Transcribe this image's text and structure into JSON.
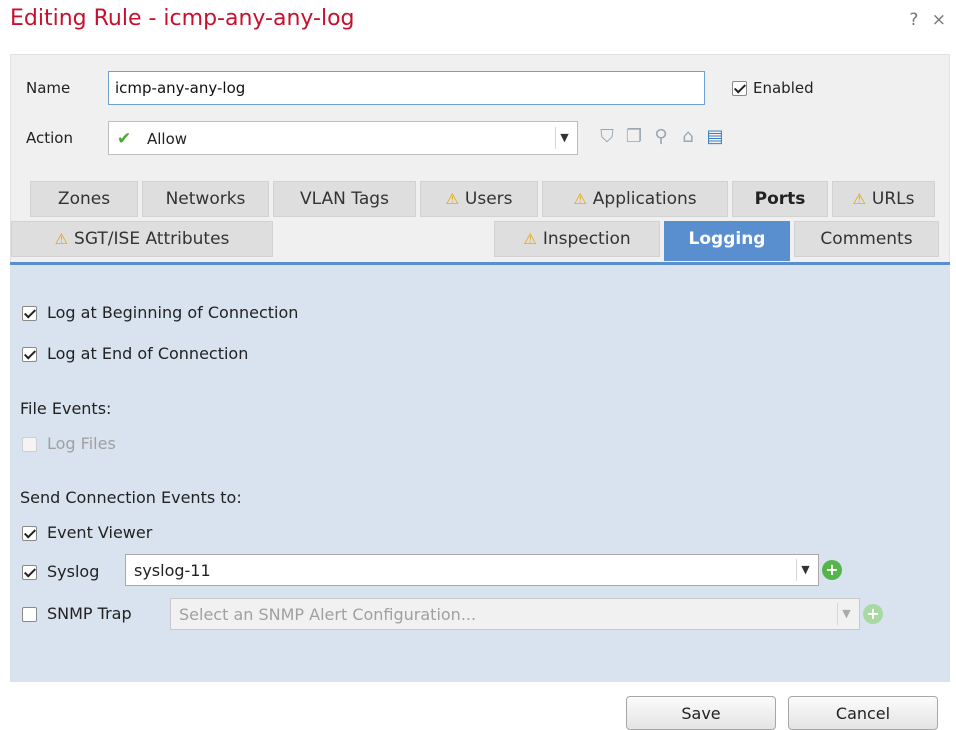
{
  "dialog": {
    "title": "Editing Rule - icmp-any-any-log",
    "help_glyph": "?",
    "close_glyph": "×"
  },
  "name": {
    "label": "Name",
    "value": "icmp-any-any-log"
  },
  "enabled": {
    "label": "Enabled",
    "checked": true
  },
  "action": {
    "label": "Action",
    "value": "Allow",
    "icon": "check-icon"
  },
  "tabs_row1": [
    {
      "label": "Zones",
      "warn": false,
      "bold": false
    },
    {
      "label": "Networks",
      "warn": false,
      "bold": false
    },
    {
      "label": "VLAN Tags",
      "warn": false,
      "bold": false
    },
    {
      "label": "Users",
      "warn": true,
      "bold": false
    },
    {
      "label": "Applications",
      "warn": true,
      "bold": false
    },
    {
      "label": "Ports",
      "warn": false,
      "bold": true
    },
    {
      "label": "URLs",
      "warn": true,
      "bold": false
    }
  ],
  "tabs_row2": [
    {
      "label": "SGT/ISE Attributes",
      "warn": true
    },
    {
      "label": "Inspection",
      "warn": true
    },
    {
      "label": "Logging",
      "active": true
    },
    {
      "label": "Comments"
    }
  ],
  "logging": {
    "log_beginning": {
      "label": "Log at Beginning of Connection",
      "checked": true
    },
    "log_end": {
      "label": "Log at End of Connection",
      "checked": true
    },
    "file_events_heading": "File Events:",
    "log_files": {
      "label": "Log Files",
      "checked": false,
      "disabled": true
    },
    "send_heading": "Send Connection Events to:",
    "event_viewer": {
      "label": "Event Viewer",
      "checked": true
    },
    "syslog": {
      "label": "Syslog",
      "checked": true,
      "value": "syslog-11"
    },
    "snmp": {
      "label": "SNMP Trap",
      "checked": false,
      "placeholder": "Select an SNMP Alert Configuration..."
    }
  },
  "footer": {
    "save_label": "Save",
    "cancel_label": "Cancel"
  },
  "colors": {
    "title": "#c8102e",
    "tab_active": "#5a8fcf",
    "panel_bg": "#d8e3ef",
    "warn": "#e3a200",
    "add": "#55b44a"
  }
}
